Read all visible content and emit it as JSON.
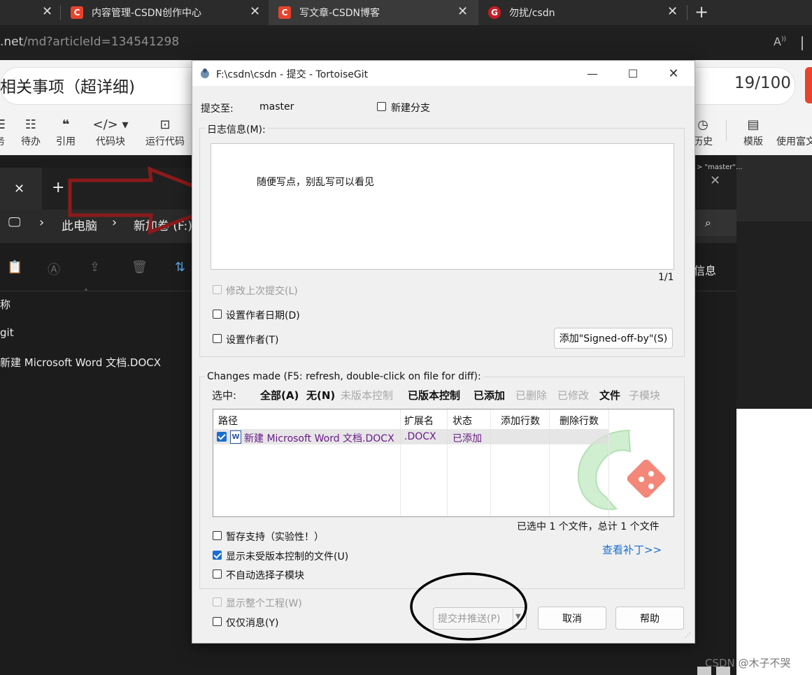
{
  "browser": {
    "tabs": [
      {
        "title": "内容管理-CSDN创作中心",
        "icon": "csdn-icon"
      },
      {
        "title": "写文章-CSDN博客",
        "icon": "csdn-icon"
      },
      {
        "title": "勿扰/csdn",
        "icon": "gitee-icon"
      }
    ],
    "url_host": ".net",
    "url_path": "/md?articleId=134541298"
  },
  "editor": {
    "article_title": "相关事项（超详细)",
    "word_count": "19/100",
    "toolbar_left": [
      {
        "label": "待办",
        "icon": "list-icon"
      },
      {
        "label": "引用",
        "icon": "quote-icon"
      },
      {
        "label": "代码块",
        "icon": "code-icon"
      },
      {
        "label": "运行代码",
        "icon": "run-code-icon"
      }
    ],
    "toolbar_right": [
      {
        "label": "历史",
        "icon": "history-icon"
      },
      {
        "label": "模版",
        "icon": "template-icon"
      },
      {
        "label": "使用富文",
        "icon": "richtext-icon"
      }
    ]
  },
  "explorer": {
    "breadcrumb": [
      "此电脑",
      "新加卷 (F:)"
    ],
    "details_label": "信息",
    "col_name": "称",
    "files": [
      "git",
      "新建 Microsoft Word 文档.DOCX"
    ]
  },
  "dialog": {
    "title": "F:\\csdn\\csdn - 提交 - TortoiseGit",
    "commit_to_label": "提交至:",
    "branch": "master",
    "new_branch_label": "新建分支",
    "log_group_label": "日志信息(M):",
    "message": "随便写点，别乱写可以看见",
    "line_counter": "1/1",
    "amend_label": "修改上次提交(L)",
    "set_author_date_label": "设置作者日期(D)",
    "set_author_label": "设置作者(T)",
    "signed_off_button": "添加\"Signed-off-by\"(S)",
    "changes_group_label": "Changes made (F5: refresh, double-click on file for diff):",
    "select_label": "选中:",
    "filters": [
      {
        "label": "全部(A)",
        "state": "bold"
      },
      {
        "label": "无(N)",
        "state": "bold"
      },
      {
        "label": "未版本控制",
        "state": "gray"
      },
      {
        "label": "已版本控制",
        "state": "bold"
      },
      {
        "label": "已添加",
        "state": "bold"
      },
      {
        "label": "已删除",
        "state": "gray"
      },
      {
        "label": "已修改",
        "state": "gray"
      },
      {
        "label": "文件",
        "state": "bold"
      },
      {
        "label": "子模块",
        "state": "gray"
      }
    ],
    "columns": [
      "路径",
      "扩展名",
      "状态",
      "添加行数",
      "删除行数"
    ],
    "files": [
      {
        "path": "新建 Microsoft Word 文档.DOCX",
        "ext": ".DOCX",
        "status": "已添加",
        "added": "",
        "deleted": "",
        "checked": true
      }
    ],
    "selection_summary": "已选中 1 个文件，总计 1 个文件",
    "view_patch_link": "查看补丁>>",
    "stash_label": "暂存支持（实验性！）",
    "show_unversioned_label": "显示未受版本控制的文件(U)",
    "no_autoselect_submodules_label": "不自动选择子模块",
    "show_whole_project_label": "显示整个工程(W)",
    "message_only_label": "仅仅消息(Y)",
    "commit_push_button": "提交并推送(P)",
    "cancel_button": "取消",
    "help_button": "帮助"
  },
  "watermark": "CSDN @木子不哭",
  "colors": {
    "arrow": "#8b1a1a",
    "circle": "#000000",
    "accent": "#1a6dd1",
    "csdn_red": "#e8432c",
    "path_purple": "#6a1a8a"
  }
}
